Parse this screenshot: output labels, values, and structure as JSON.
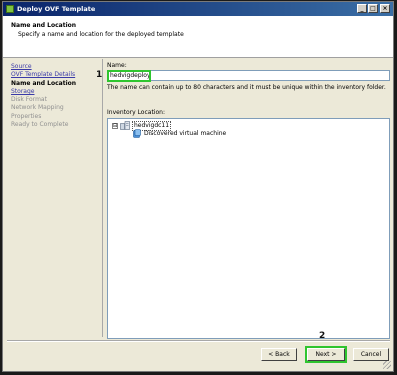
{
  "window": {
    "title": "Deploy OVF Template",
    "controls": {
      "minimize": "_",
      "maximize": "□",
      "close": "×"
    }
  },
  "header": {
    "title": "Name and Location",
    "subtitle": "Specify a name and location for the deployed template"
  },
  "steps": [
    {
      "label": "Source",
      "state": "done"
    },
    {
      "label": "OVF Template Details",
      "state": "done"
    },
    {
      "label": "Name and Location",
      "state": "current"
    },
    {
      "label": "Storage",
      "state": "done"
    },
    {
      "label": "Disk Format",
      "state": "future"
    },
    {
      "label": "Network Mapping",
      "state": "future"
    },
    {
      "label": "Properties",
      "state": "future"
    },
    {
      "label": "Ready to Complete",
      "state": "future"
    }
  ],
  "form": {
    "name_label": "Name:",
    "name_value": "hedvigdeploy",
    "name_hint": "The name can contain up to 80 characters and it must be unique within the inventory folder.",
    "inventory_label": "Inventory Location:"
  },
  "tree": {
    "expander": "⊟",
    "datacenter": "hedvigdc11",
    "folder": "Discovered virtual machine"
  },
  "annotations": {
    "marker1": "1",
    "marker2": "2",
    "highlight_color": "#2fc52f"
  },
  "buttons": {
    "back": "< Back",
    "next": "Next >",
    "cancel": "Cancel"
  },
  "colors": {
    "titlebar": "#0a246a",
    "link": "#3a3aa8",
    "dialog_bg": "#ece9d8"
  }
}
